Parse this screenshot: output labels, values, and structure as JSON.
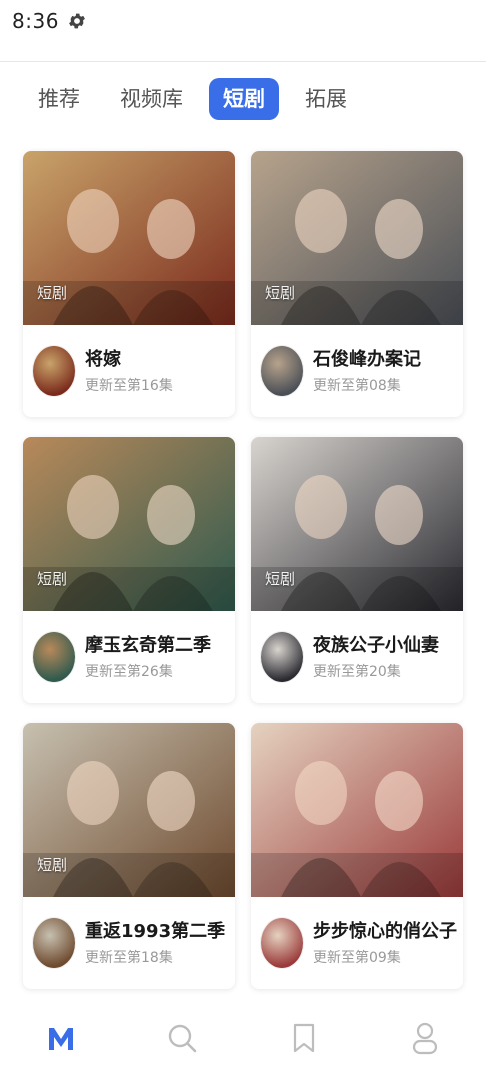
{
  "status": {
    "time": "8:36",
    "settings_icon": "gear-icon"
  },
  "tabs": [
    {
      "label": "推荐",
      "active": false
    },
    {
      "label": "视频库",
      "active": false
    },
    {
      "label": "短剧",
      "active": true
    },
    {
      "label": "拓展",
      "active": false
    }
  ],
  "cards": [
    {
      "tag": "短剧",
      "title": "将嫁",
      "subtitle": "更新至第16集",
      "theme": [
        "#7a2a1c",
        "#c9a36a"
      ]
    },
    {
      "tag": "短剧",
      "title": "石俊峰办案记",
      "subtitle": "更新至第08集",
      "theme": [
        "#4a4f56",
        "#b7a38c"
      ]
    },
    {
      "tag": "短剧",
      "title": "摩玉玄奇第二季",
      "subtitle": "更新至第26集",
      "theme": [
        "#2f5a4e",
        "#b8895a"
      ]
    },
    {
      "tag": "短剧",
      "title": "夜族公子小仙妻",
      "subtitle": "更新至第20集",
      "theme": [
        "#2a2a30",
        "#d8d4cf"
      ]
    },
    {
      "tag": "短剧",
      "title": "重返1993第二季",
      "subtitle": "更新至第18集",
      "theme": [
        "#6e4a2e",
        "#c7c0b0"
      ]
    },
    {
      "tag": "",
      "title": "步步惊心的俏公子",
      "subtitle": "更新至第09集",
      "theme": [
        "#9a3a3a",
        "#e5d2c0"
      ]
    }
  ],
  "bottom_nav": [
    {
      "icon": "m-logo-icon",
      "active": true
    },
    {
      "icon": "search-icon",
      "active": false
    },
    {
      "icon": "bookmark-icon",
      "active": false
    },
    {
      "icon": "profile-icon",
      "active": false
    }
  ],
  "colors": {
    "accent": "#3a6ee8",
    "nav_inactive": "#bdbdbd"
  }
}
